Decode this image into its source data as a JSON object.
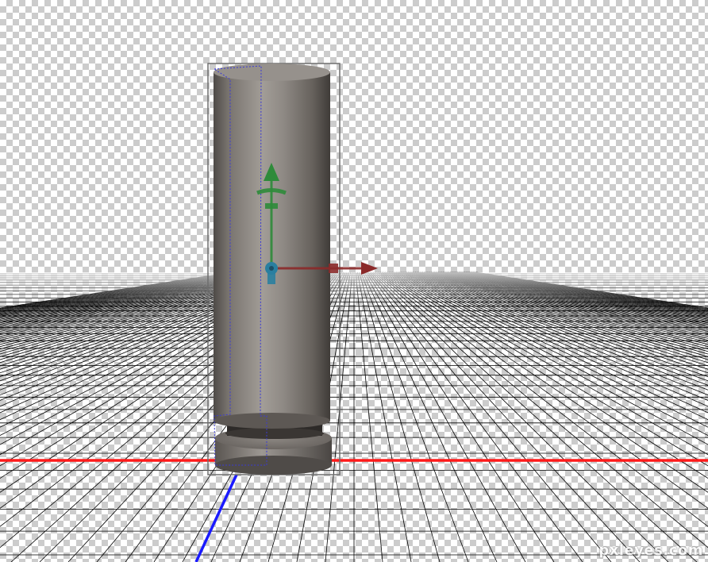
{
  "scene": {
    "ground_grid_color": "#000000",
    "x_axis_color": "#ff1a1a",
    "z_axis_color": "#1a1aff",
    "object_color": "#8a8580",
    "gizmo": {
      "y_handle_color": "#2e8b3a",
      "x_handle_color": "#8b2a2a",
      "pivot_color": "#2a7fa0"
    }
  },
  "watermark": {
    "text": "pxleyes.com"
  }
}
